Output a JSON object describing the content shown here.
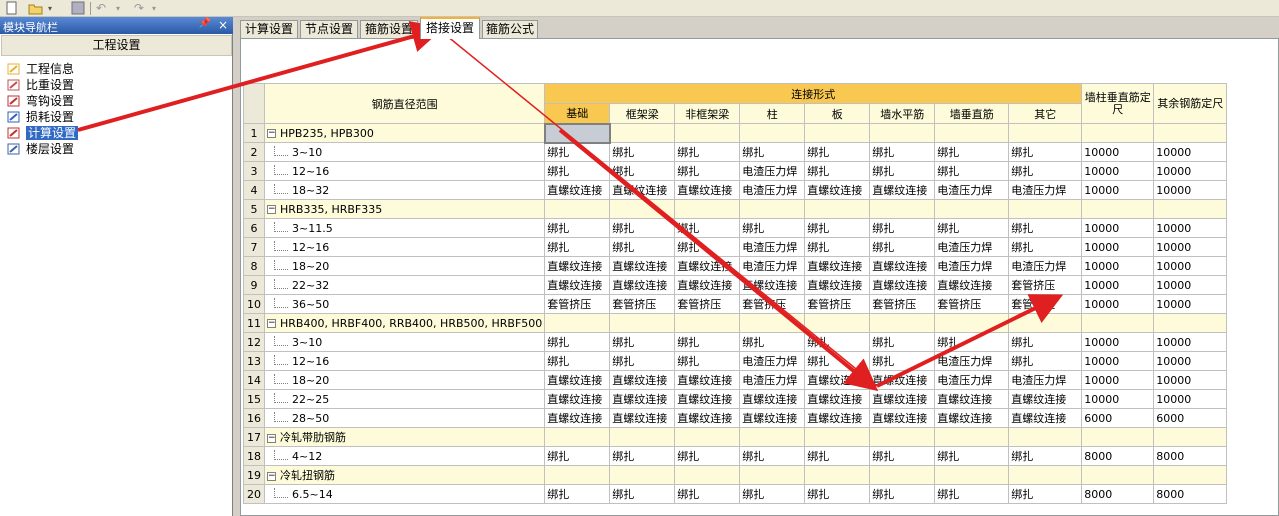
{
  "nav": {
    "title": "模块导航栏",
    "header": "工程设置",
    "items": [
      {
        "label": "工程信息",
        "icon": "folder-info-icon"
      },
      {
        "label": "比重设置",
        "icon": "weight-icon"
      },
      {
        "label": "弯钩设置",
        "icon": "hook-icon"
      },
      {
        "label": "损耗设置",
        "icon": "loss-icon"
      },
      {
        "label": "计算设置",
        "icon": "calc-settings-icon"
      },
      {
        "label": "楼层设置",
        "icon": "floor-icon"
      }
    ],
    "selected_index": 4
  },
  "tabs": [
    "计算设置",
    "节点设置",
    "箍筋设置",
    "搭接设置",
    "箍筋公式"
  ],
  "active_tab": 3,
  "table": {
    "col_range": "钢筋直径范围",
    "col_conn": "连接形式",
    "sub_cols": [
      "基础",
      "框架梁",
      "非框架梁",
      "柱",
      "板",
      "墙水平筋",
      "墙垂直筋",
      "其它"
    ],
    "col_wall_len": "墙柱垂直筋定尺",
    "col_other_len": "其余钢筋定尺",
    "rows": [
      {
        "n": "1",
        "group": true,
        "label": "HPB235, HPB300"
      },
      {
        "n": "2",
        "label": "3~10",
        "c": [
          "绑扎",
          "绑扎",
          "绑扎",
          "绑扎",
          "绑扎",
          "绑扎",
          "绑扎",
          "绑扎"
        ],
        "a": "10000",
        "b": "10000"
      },
      {
        "n": "3",
        "label": "12~16",
        "c": [
          "绑扎",
          "绑扎",
          "绑扎",
          "电渣压力焊",
          "绑扎",
          "绑扎",
          "绑扎",
          "绑扎"
        ],
        "a": "10000",
        "b": "10000"
      },
      {
        "n": "4",
        "label": "18~32",
        "c": [
          "直螺纹连接",
          "直螺纹连接",
          "直螺纹连接",
          "电渣压力焊",
          "直螺纹连接",
          "直螺纹连接",
          "电渣压力焊",
          "电渣压力焊"
        ],
        "a": "10000",
        "b": "10000"
      },
      {
        "n": "5",
        "group": true,
        "label": "HRB335, HRBF335"
      },
      {
        "n": "6",
        "label": "3~11.5",
        "c": [
          "绑扎",
          "绑扎",
          "绑扎",
          "绑扎",
          "绑扎",
          "绑扎",
          "绑扎",
          "绑扎"
        ],
        "a": "10000",
        "b": "10000"
      },
      {
        "n": "7",
        "label": "12~16",
        "c": [
          "绑扎",
          "绑扎",
          "绑扎",
          "电渣压力焊",
          "绑扎",
          "绑扎",
          "电渣压力焊",
          "绑扎"
        ],
        "a": "10000",
        "b": "10000"
      },
      {
        "n": "8",
        "label": "18~20",
        "c": [
          "直螺纹连接",
          "直螺纹连接",
          "直螺纹连接",
          "电渣压力焊",
          "直螺纹连接",
          "直螺纹连接",
          "电渣压力焊",
          "电渣压力焊"
        ],
        "a": "10000",
        "b": "10000"
      },
      {
        "n": "9",
        "label": "22~32",
        "c": [
          "直螺纹连接",
          "直螺纹连接",
          "直螺纹连接",
          "直螺纹连接",
          "直螺纹连接",
          "直螺纹连接",
          "直螺纹连接",
          "套管挤压"
        ],
        "a": "10000",
        "b": "10000"
      },
      {
        "n": "10",
        "label": "36~50",
        "c": [
          "套管挤压",
          "套管挤压",
          "套管挤压",
          "套管挤压",
          "套管挤压",
          "套管挤压",
          "套管挤压",
          "套管挤压"
        ],
        "a": "10000",
        "b": "10000"
      },
      {
        "n": "11",
        "group": true,
        "label": "HRB400, HRBF400, RRB400, HRB500, HRBF500"
      },
      {
        "n": "12",
        "label": "3~10",
        "c": [
          "绑扎",
          "绑扎",
          "绑扎",
          "绑扎",
          "绑扎",
          "绑扎",
          "绑扎",
          "绑扎"
        ],
        "a": "10000",
        "b": "10000"
      },
      {
        "n": "13",
        "label": "12~16",
        "c": [
          "绑扎",
          "绑扎",
          "绑扎",
          "电渣压力焊",
          "绑扎",
          "绑扎",
          "电渣压力焊",
          "绑扎"
        ],
        "a": "10000",
        "b": "10000"
      },
      {
        "n": "14",
        "label": "18~20",
        "c": [
          "直螺纹连接",
          "直螺纹连接",
          "直螺纹连接",
          "电渣压力焊",
          "直螺纹连接",
          "直螺纹连接",
          "电渣压力焊",
          "电渣压力焊"
        ],
        "a": "10000",
        "b": "10000"
      },
      {
        "n": "15",
        "label": "22~25",
        "c": [
          "直螺纹连接",
          "直螺纹连接",
          "直螺纹连接",
          "直螺纹连接",
          "直螺纹连接",
          "直螺纹连接",
          "直螺纹连接",
          "直螺纹连接"
        ],
        "a": "10000",
        "b": "10000"
      },
      {
        "n": "16",
        "label": "28~50",
        "c": [
          "直螺纹连接",
          "直螺纹连接",
          "直螺纹连接",
          "直螺纹连接",
          "直螺纹连接",
          "直螺纹连接",
          "直螺纹连接",
          "直螺纹连接"
        ],
        "a": "6000",
        "b": "6000"
      },
      {
        "n": "17",
        "group": true,
        "label": "冷轧带肋钢筋"
      },
      {
        "n": "18",
        "label": "4~12",
        "c": [
          "绑扎",
          "绑扎",
          "绑扎",
          "绑扎",
          "绑扎",
          "绑扎",
          "绑扎",
          "绑扎"
        ],
        "a": "8000",
        "b": "8000"
      },
      {
        "n": "19",
        "group": true,
        "label": "冷轧扭钢筋"
      },
      {
        "n": "20",
        "label": "6.5~14",
        "c": [
          "绑扎",
          "绑扎",
          "绑扎",
          "绑扎",
          "绑扎",
          "绑扎",
          "绑扎",
          "绑扎"
        ],
        "a": "8000",
        "b": "8000"
      }
    ]
  },
  "colors": {
    "annotation_arrow": "#e02020",
    "selection": "#316ac5",
    "header_orange": "#f8c850"
  }
}
